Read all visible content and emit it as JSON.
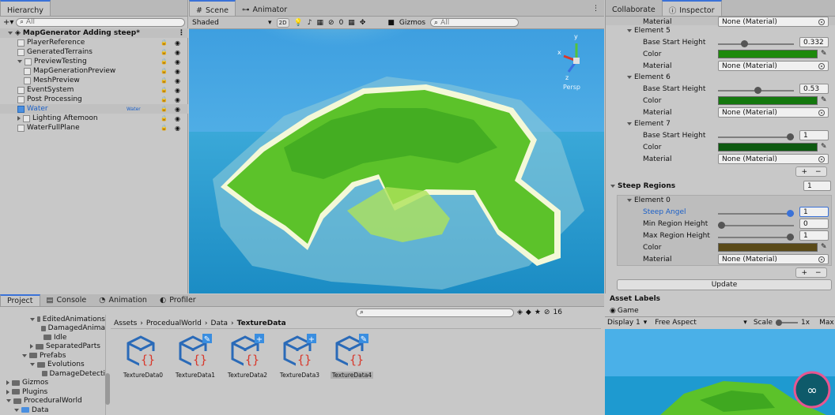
{
  "hierarchy": {
    "tab": "Hierarchy",
    "search_placeholder": "All",
    "root": "MapGenerator Adding steep*",
    "items": [
      {
        "label": "PlayerReference",
        "indent": 1
      },
      {
        "label": "GeneratedTerrains",
        "indent": 1
      },
      {
        "label": "PreviewTesting",
        "indent": 1
      },
      {
        "label": "MapGenerationPreview",
        "indent": 2
      },
      {
        "label": "MeshPreview",
        "indent": 2
      },
      {
        "label": "EventSystem",
        "indent": 1
      },
      {
        "label": "Post Processing",
        "indent": 1
      },
      {
        "label": "Water",
        "indent": 1,
        "badge": "Water"
      },
      {
        "label": "Lighting Aftemoon",
        "indent": 1
      },
      {
        "label": "WaterFullPlane",
        "indent": 1
      }
    ]
  },
  "scene": {
    "tabs": [
      "Scene",
      "Animator"
    ],
    "shading": "Shaded",
    "mode2d": "2D",
    "gizmo_count": "0",
    "gizmos": "Gizmos",
    "search_placeholder": "All",
    "persp": "Persp",
    "axes": {
      "x": "x",
      "y": "y",
      "z": "z"
    }
  },
  "inspector": {
    "tabs": [
      "Collaborate",
      "Inspector"
    ],
    "top_material": {
      "label": "Material",
      "value": "None (Material)"
    },
    "elements": [
      {
        "title": "Element 5",
        "height_label": "Base Start Height",
        "height": "0.332",
        "height_frac": 0.332,
        "color": "#1e8a0c",
        "mat_label": "Material",
        "mat_value": "None (Material)",
        "color_label": "Color"
      },
      {
        "title": "Element 6",
        "height_label": "Base Start Height",
        "height": "0.53",
        "height_frac": 0.53,
        "color": "#14780e",
        "mat_label": "Material",
        "mat_value": "None (Material)",
        "color_label": "Color"
      },
      {
        "title": "Element 7",
        "height_label": "Base Start Height",
        "height": "1",
        "height_frac": 1.0,
        "color": "#0d5a10",
        "mat_label": "Material",
        "mat_value": "None (Material)",
        "color_label": "Color"
      }
    ],
    "plus": "+",
    "minus": "−",
    "steep": {
      "title": "Steep Regions",
      "count": "1",
      "element": "Element 0",
      "angle_label": "Steep Angel",
      "angle": "1",
      "angle_frac": 1.0,
      "min_label": "Min Region Height",
      "min": "0",
      "min_frac": 0.0,
      "max_label": "Max Region Height",
      "max": "1",
      "max_frac": 1.0,
      "color_label": "Color",
      "color": "#5a4a18",
      "mat_label": "Material",
      "mat_value": "None (Material)"
    },
    "update": "Update",
    "asset_labels": "Asset Labels"
  },
  "project": {
    "tabs": [
      "Project",
      "Console",
      "Animation",
      "Profiler"
    ],
    "count": "16",
    "tree": [
      {
        "label": "EditedAnimations",
        "indent": 3
      },
      {
        "label": "DamagedAnima",
        "indent": 4
      },
      {
        "label": "Idle",
        "indent": 4
      },
      {
        "label": "SeparatedParts",
        "indent": 3
      },
      {
        "label": "Prefabs",
        "indent": 2
      },
      {
        "label": "Evolutions",
        "indent": 3
      },
      {
        "label": "DamageDetecti",
        "indent": 4
      },
      {
        "label": "Gizmos",
        "indent": 0
      },
      {
        "label": "Plugins",
        "indent": 0
      },
      {
        "label": "ProceduralWorld",
        "indent": 0
      },
      {
        "label": "Data",
        "indent": 1
      }
    ],
    "breadcrumb": [
      "Assets",
      "ProcedualWorld",
      "Data",
      "TextureData"
    ],
    "assets": [
      "TextureData0",
      "TextureData1",
      "TextureData2",
      "TextureData3",
      "TextureData4"
    ]
  },
  "game": {
    "tab": "Game",
    "display": "Display 1",
    "aspect": "Free Aspect",
    "scale_label": "Scale",
    "scale": "1x",
    "max": "Max"
  },
  "colors": {
    "accent": "#3a72d8",
    "sky": "#4ab0e8",
    "ocean": "#1e9ad0",
    "land": "#5cc22a"
  }
}
